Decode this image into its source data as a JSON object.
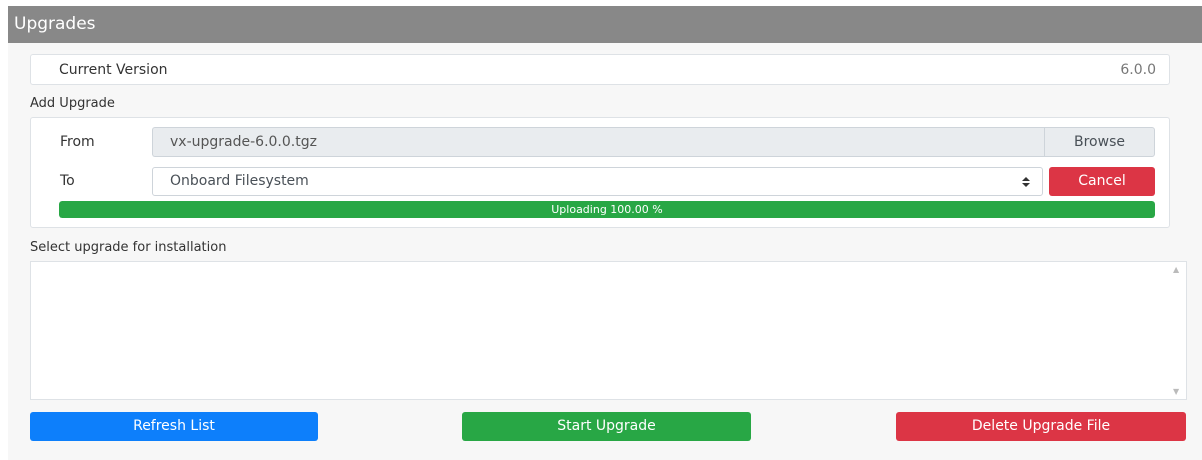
{
  "header": {
    "title": "Upgrades"
  },
  "current_version": {
    "label": "Current Version",
    "value": "6.0.0"
  },
  "add_upgrade": {
    "section_label": "Add Upgrade",
    "from_label": "From",
    "file_value": "vx-upgrade-6.0.0.tgz",
    "browse_label": "Browse",
    "to_label": "To",
    "destination_selected": "Onboard Filesystem",
    "cancel_label": "Cancel",
    "progress": {
      "text": "Uploading 100.00 %",
      "percent": 100
    }
  },
  "install": {
    "section_label": "Select upgrade for installation",
    "items": []
  },
  "actions": {
    "refresh_label": "Refresh List",
    "start_label": "Start Upgrade",
    "delete_label": "Delete Upgrade File"
  },
  "colors": {
    "header_bg": "#888888",
    "primary": "#0d7ffb",
    "success": "#28a745",
    "danger": "#dc3545"
  },
  "icons": {
    "select_arrows": "up-down-chevron-icon",
    "scroll_up": "scroll-up-arrow-icon",
    "scroll_down": "scroll-down-arrow-icon"
  }
}
